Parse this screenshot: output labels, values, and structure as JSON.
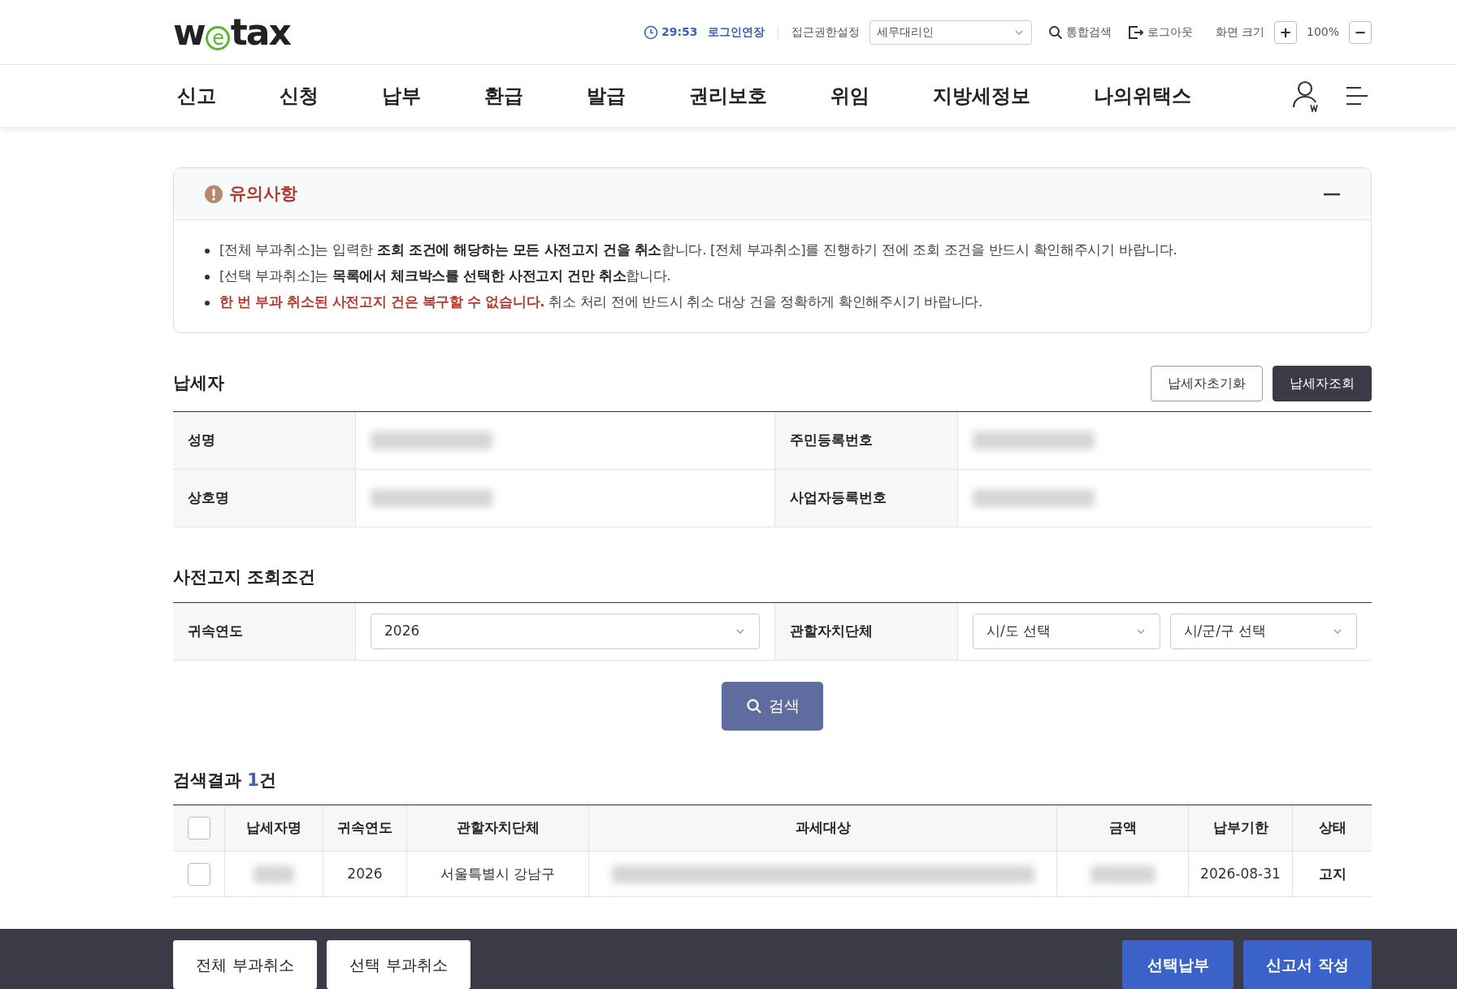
{
  "header": {
    "logo": "wetax",
    "timer": "29:53",
    "extend_login": "로그인연장",
    "access_label": "접근권한설정",
    "access_select": "세무대리인",
    "search": "통합검색",
    "logout": "로그아웃",
    "zoom_label": "화면 크기",
    "zoom_in": "+",
    "zoom_value": "100%",
    "zoom_out": "−"
  },
  "nav": {
    "items": [
      "신고",
      "신청",
      "납부",
      "환급",
      "발급",
      "권리보호",
      "위임",
      "지방세정보",
      "나의위택스"
    ]
  },
  "notice": {
    "title": "유의사항",
    "expanded": true,
    "items": [
      {
        "kind": "normal",
        "text": "[전체 부과취소]는 입력한 **조회 조건에 해당하는 모든 사전고지 건을 취소**합니다. [전체 부과취소]를 진행하기 전에 조회 조건을 반드시 확인해주시기 바랍니다."
      },
      {
        "kind": "normal",
        "text": "[선택 부과취소]는 **목록에서 체크박스를 선택한 사전고지 건만 취소**합니다."
      },
      {
        "kind": "warning",
        "text": "**한 번 부과 취소된 사전고지 건은 복구할 수 없습니다.** 취소 처리 전에 반드시 취소 대상 건을 정확하게 확인해주시기 바랍니다."
      }
    ]
  },
  "taxpayer": {
    "title": "납세자",
    "buttons": [
      {
        "label": "납세자초기화",
        "kind": "outline"
      },
      {
        "label": "납세자조회",
        "kind": "dark"
      }
    ],
    "fields": [
      {
        "label": "성명",
        "kind": "redacted"
      },
      {
        "label": "주민등록번호",
        "kind": "redacted"
      },
      {
        "label": "상호명",
        "kind": "redacted"
      },
      {
        "label": "사업자등록번호",
        "kind": "redacted"
      }
    ]
  },
  "conditions": {
    "title": "사전고지 조회조건",
    "year_label": "귀속연도",
    "year_value": "2026",
    "region_label": "관할자치단체",
    "province_placeholder": "시/도 선택",
    "district_placeholder": "시/군/구 선택",
    "search_button": "검색"
  },
  "results": {
    "title_before": "검색결과 ",
    "count": "1",
    "title_after": "건",
    "all_checked": false,
    "columns": [
      "납세자명",
      "귀속연도",
      "관할자치단체",
      "과세대상",
      "금액",
      "납부기한",
      "상태"
    ],
    "rows": [
      {
        "checked": false,
        "cells": [
          {
            "kind": "redacted"
          },
          {
            "kind": "text",
            "text": "2026"
          },
          {
            "kind": "text",
            "text": "서울특별시 강남구"
          },
          {
            "kind": "redacted"
          },
          {
            "kind": "redacted"
          },
          {
            "kind": "text",
            "text": "2026-08-31"
          },
          {
            "kind": "status",
            "text": "고지"
          }
        ]
      }
    ]
  },
  "bottom_bar": {
    "left_buttons": [
      "전체 부과취소",
      "선택 부과취소"
    ],
    "right_buttons": [
      "선택납부",
      "신고서 작성"
    ]
  }
}
